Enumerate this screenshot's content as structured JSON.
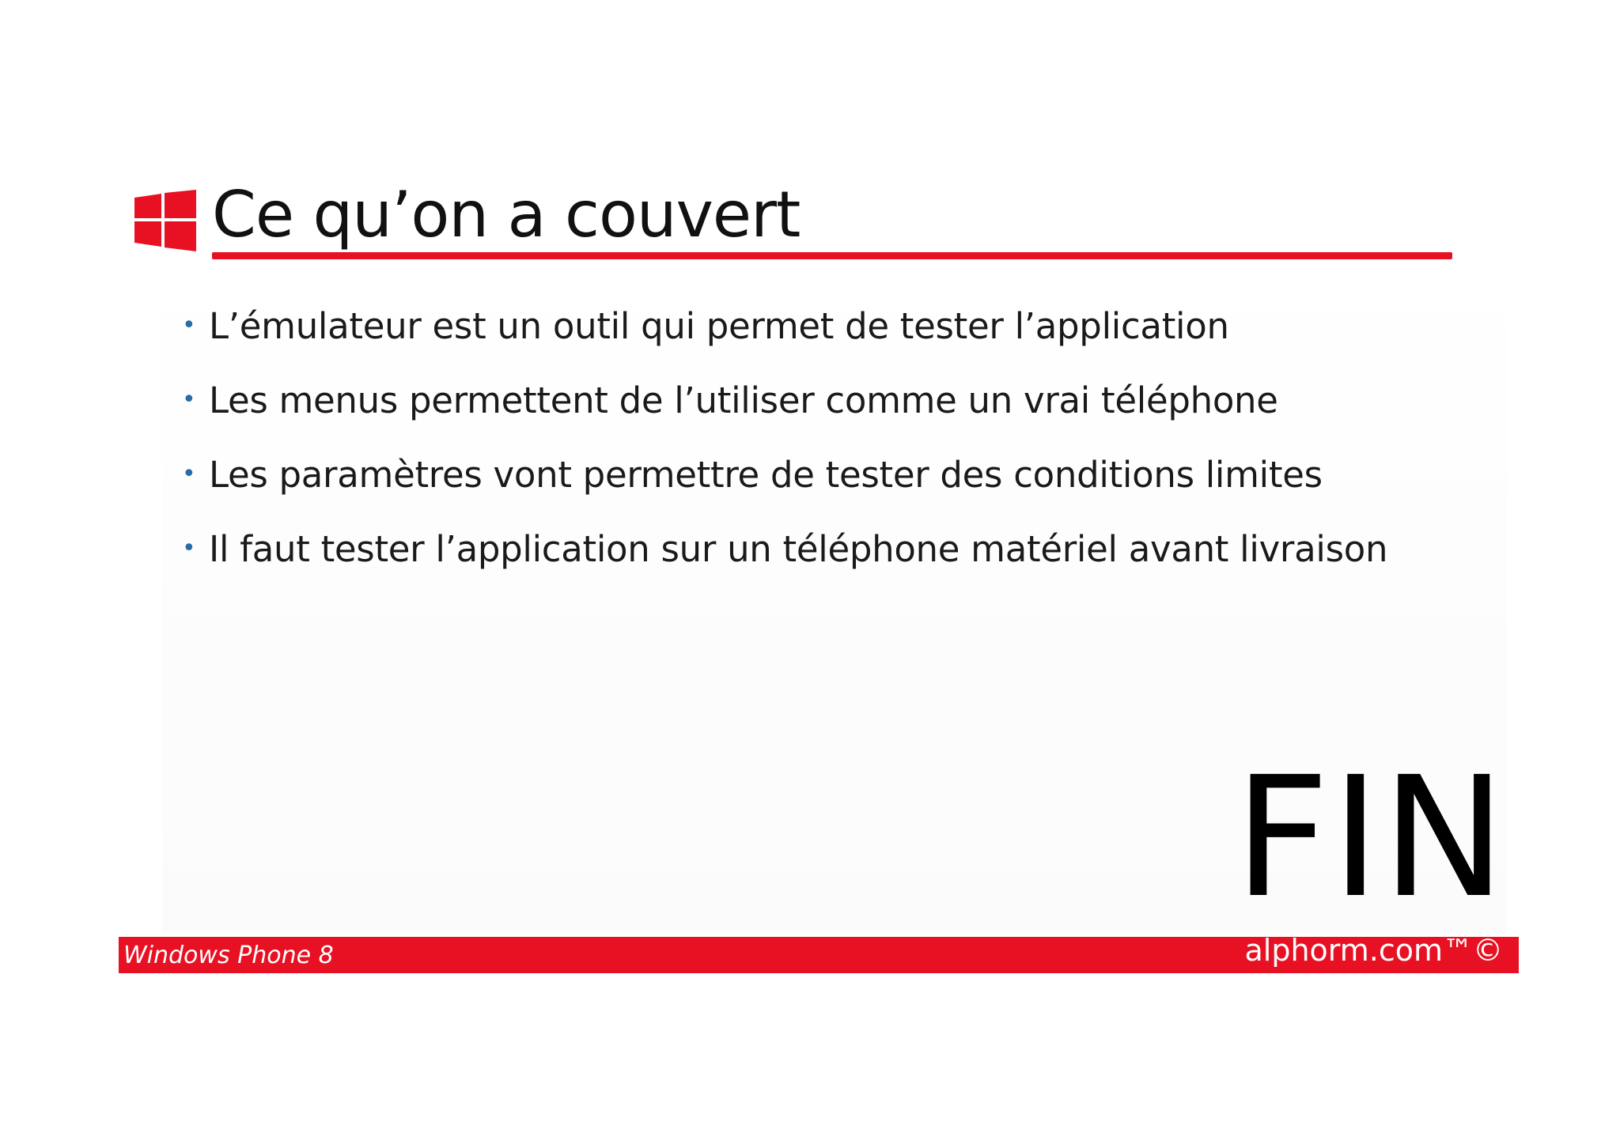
{
  "slide": {
    "title": "Ce qu’on a couvert",
    "bullets": [
      "L’émulateur est un outil qui permet de tester l’application",
      "Les menus permettent de l’utiliser comme un vrai téléphone",
      "Les paramètres vont permettre de tester des conditions limites",
      "Il faut tester l’application sur un téléphone matériel avant livraison"
    ],
    "bullet_glyph": "•",
    "end_label": "FIN"
  },
  "footer": {
    "course": "Windows Phone 8",
    "brand": "alphorm.com™©"
  },
  "colors": {
    "accent": "#e81123",
    "bullet": "#2a6ca8",
    "text": "#1a1a1a"
  },
  "icons": {
    "logo": "windows-logo-icon"
  }
}
